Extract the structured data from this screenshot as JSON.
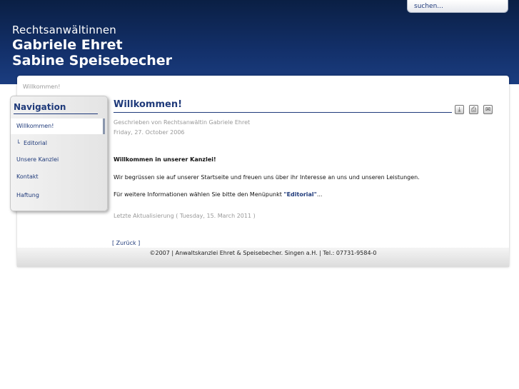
{
  "header": {
    "search_label": "suchen...",
    "title_line1": "Rechtsanwältinnen",
    "title_line2": "Gabriele Ehret",
    "title_line3": "Sabine Speisebecher"
  },
  "breadcrumb": "Willkommen!",
  "nav": {
    "title": "Navigation",
    "items": [
      {
        "label": "Willkommen!"
      },
      {
        "label": "Editorial",
        "sub": true
      },
      {
        "label": "Unsere Kanzlei"
      },
      {
        "label": "Kontakt"
      },
      {
        "label": "Haftung"
      }
    ],
    "sub_marker": "└"
  },
  "article": {
    "title": "Willkommen!",
    "author": "Geschrieben von Rechtsanwältin Gabriele Ehret",
    "date": "Friday, 27. October 2006",
    "heading": "Willkommen in unserer Kanzlei!",
    "para1": "Wir begrüssen sie auf unserer Startseite und freuen uns über ihr Interesse an uns und unseren Leistungen.",
    "para2_prefix": "Für weitere Informationen wählen Sie bitte den Menüpunkt ",
    "para2_link": "\"Editorial\"",
    "para2_suffix": "...",
    "last_updated": "Letzte Aktualisierung ( Tuesday, 15. March 2011 )",
    "back": "[ Zurück ]"
  },
  "icons": [
    "pdf-icon",
    "print-icon",
    "email-icon"
  ],
  "footer": "©2007 | Anwaltskanzlei Ehret & Speisebecher. Singen a.H. | Tel.: 07731-9584-0"
}
